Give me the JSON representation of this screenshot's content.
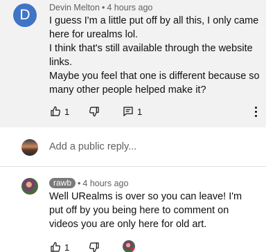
{
  "comment1": {
    "avatar_letter": "D",
    "author": "Devin Melton",
    "time": "4 hours ago",
    "lines": [
      "I guess I'm a little put off by all this, I only came here for urealms lol.",
      "I think that's still available through the website links.",
      "Maybe you feel that one is different because so many other people helped make it?"
    ],
    "likes": "1",
    "replies": "1",
    "avatar_color": "#3f74c6"
  },
  "reply_box": {
    "placeholder": "Add a public reply..."
  },
  "comment2": {
    "author": "rawb",
    "time": "4 hours ago",
    "text": "Well URealms is over so you can leave! I'm put off by you being here to comment on videos you are only here for old art.",
    "likes": "1"
  },
  "icons": {
    "like": "thumbs-up-icon",
    "dislike": "thumbs-down-icon",
    "reply": "reply-comment-icon",
    "more": "more-vertical-icon",
    "heart": "creator-heart-icon"
  }
}
